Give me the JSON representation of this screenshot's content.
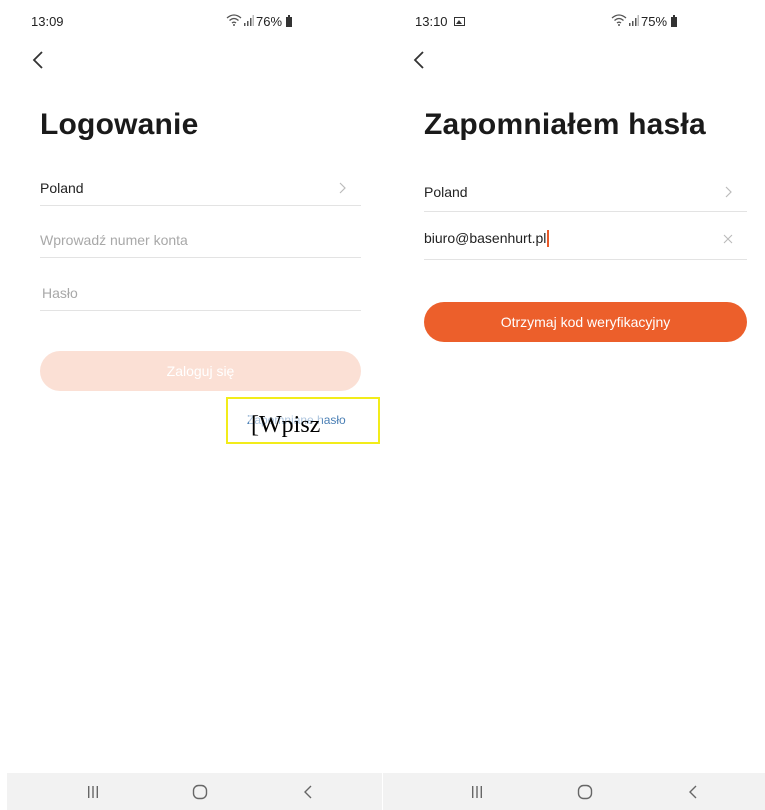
{
  "login_screen": {
    "status": {
      "time": "13:09",
      "battery": "76%"
    },
    "title": "Logowanie",
    "country": "Poland",
    "account_placeholder": "Wprowadź numer konta",
    "password_placeholder": "Hasło",
    "login_button": "Zaloguj się",
    "forgot_link": "Zapomniane hasło",
    "overlay_text": "[Wpisz"
  },
  "forgot_screen": {
    "status": {
      "time": "13:10",
      "battery": "75%"
    },
    "title": "Zapomniałem hasła",
    "country": "Poland",
    "email_value": "biuro@basenhurt.pl",
    "code_button": "Otrzymaj kod weryfikacyjny"
  },
  "icons": {
    "back": "chevron-left-icon",
    "row_next": "chevron-right-icon",
    "clear": "close-icon",
    "wifi": "wifi-icon",
    "signal": "signal-icon",
    "battery": "battery-icon",
    "gallery": "image-icon",
    "nav_recents": "recents-icon",
    "nav_home": "home-icon",
    "nav_back": "back-icon"
  },
  "colors": {
    "accent": "#ec5f2b",
    "accent_disabled": "#fbe0d5",
    "link": "#4a7fb5",
    "highlight": "#f2ec1a"
  }
}
